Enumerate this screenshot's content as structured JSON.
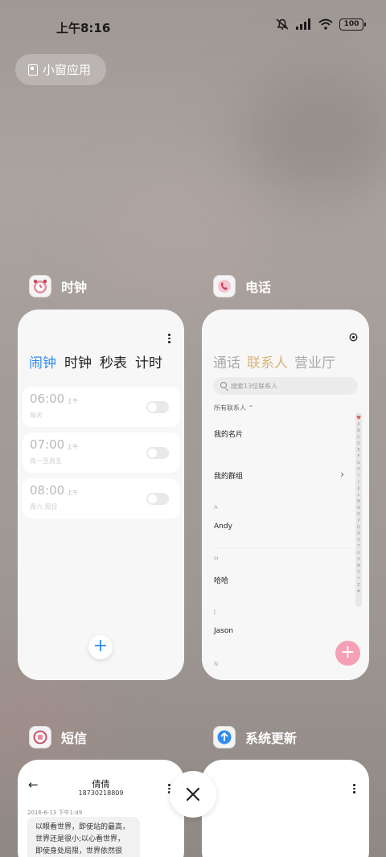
{
  "status_bar": {
    "time": "上午8:16",
    "battery": "100"
  },
  "small_window_button": "小窗应用",
  "cards": {
    "clock": {
      "title": "时钟",
      "tabs": [
        "闹钟",
        "时钟",
        "秒表",
        "计时"
      ],
      "alarms": [
        {
          "time": "06:00",
          "ampm": "上午",
          "repeat": "每天"
        },
        {
          "time": "07:00",
          "ampm": "上午",
          "repeat": "周一至周五"
        },
        {
          "time": "08:00",
          "ampm": "上午",
          "repeat": "周六 周日"
        }
      ]
    },
    "phone": {
      "title": "电话",
      "tabs": [
        "通话",
        "联系人",
        "营业厅"
      ],
      "search_placeholder": "搜索13位联系人",
      "all_contacts": "所有联系人",
      "my_card": "我的名片",
      "my_groups": "我的群组",
      "sections": [
        {
          "letter": "A",
          "name": "Andy"
        },
        {
          "letter": "H",
          "name": "哈哈"
        },
        {
          "letter": "J",
          "name": "Jason"
        },
        {
          "letter": "N",
          "name": ""
        }
      ],
      "index_letters": [
        "A",
        "B",
        "C",
        "D",
        "E",
        "F",
        "G",
        "H",
        "I",
        "J",
        "K",
        "L",
        "M",
        "N",
        "O",
        "P",
        "Q",
        "R",
        "S",
        "T",
        "U",
        "V",
        "W",
        "X",
        "Y",
        "Z",
        "#"
      ]
    },
    "sms": {
      "title": "短信",
      "contact_name": "倩倩",
      "contact_number": "18730218809",
      "date": "2016-6-13 下午1:49",
      "message": "以眼看世界，即使站的最高，世界还是很小;以心看世界，即使身处局限，世界依然很大。生活远"
    },
    "update": {
      "title": "系统更新"
    }
  },
  "colors": {
    "accent_blue": "#2f8cf0",
    "phone_gold": "#d8b47a",
    "fab_pink": "#f5a0b5"
  }
}
